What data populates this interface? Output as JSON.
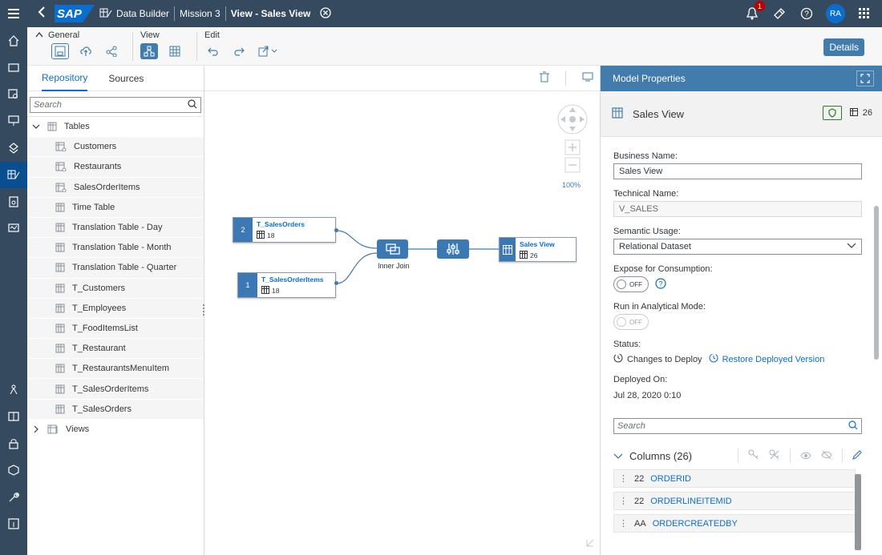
{
  "shell": {
    "app_name": "Data Builder",
    "space": "Mission 3",
    "current": "View - Sales View",
    "notification_count": "1",
    "avatar": "RA"
  },
  "toolbar": {
    "general_label": "General",
    "view_label": "View",
    "edit_label": "Edit",
    "details_label": "Details"
  },
  "repo": {
    "tab_repository": "Repository",
    "tab_sources": "Sources",
    "search_placeholder": "Search",
    "tables_label": "Tables",
    "views_label": "Views",
    "items": [
      "Customers",
      "Restaurants",
      "SalesOrderItems",
      "Time Table",
      "Translation Table - Day",
      "Translation Table - Month",
      "Translation Table - Quarter",
      "T_Customers",
      "T_Employees",
      "T_FoodItemsList",
      "T_Restaurant",
      "T_RestaurantsMenuItem",
      "T_SalesOrderItems",
      "T_SalesOrders"
    ]
  },
  "canvas": {
    "zoom": "100%",
    "node1": {
      "num": "2",
      "name": "T_SalesOrders",
      "count": "18"
    },
    "node2": {
      "num": "1",
      "name": "T_SalesOrderItems",
      "count": "18"
    },
    "join_label": "Inner Join",
    "output": {
      "name": "Sales View",
      "count": "26"
    }
  },
  "props": {
    "header": "Model Properties",
    "title": "Sales View",
    "column_count": "26",
    "business_name_label": "Business Name:",
    "business_name": "Sales View",
    "technical_name_label": "Technical Name:",
    "technical_name": "V_SALES",
    "semantic_usage_label": "Semantic Usage:",
    "semantic_usage": "Relational Dataset",
    "expose_label": "Expose for Consumption:",
    "expose_value": "OFF",
    "analytical_label": "Run in Analytical Mode:",
    "analytical_value": "OFF",
    "status_label": "Status:",
    "status_value": "Changes to Deploy",
    "restore_link": "Restore Deployed Version",
    "deployed_on_label": "Deployed On:",
    "deployed_on": "Jul 28, 2020 0:10",
    "search_placeholder": "Search",
    "columns_label": "Columns (26)",
    "columns": [
      {
        "type": "22",
        "name": "ORDERID"
      },
      {
        "type": "22",
        "name": "ORDERLINEITEMID"
      },
      {
        "type": "AA",
        "name": "ORDERCREATEDBY"
      }
    ]
  }
}
